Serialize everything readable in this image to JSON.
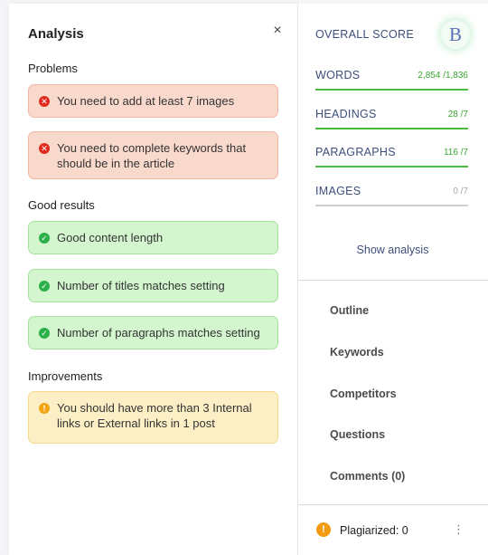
{
  "analysis": {
    "title": "Analysis",
    "close_glyph": "×",
    "problems": {
      "heading": "Problems",
      "items": [
        "You need to add at least 7 images",
        "You need to complete keywords that should be in the article"
      ]
    },
    "good": {
      "heading": "Good results",
      "items": [
        "Good content length",
        "Number of titles matches setting",
        "Number of paragraphs matches setting"
      ]
    },
    "improvements": {
      "heading": "Improvements",
      "items": [
        "You should have more than 3 Internal links or External links in 1 post"
      ]
    }
  },
  "score": {
    "label": "OVERALL SCORE",
    "grade": "B",
    "metrics": [
      {
        "label": "WORDS",
        "value": "2,854 /1,836",
        "status": "good"
      },
      {
        "label": "HEADINGS",
        "value": "28 /7",
        "status": "good"
      },
      {
        "label": "PARAGRAPHS",
        "value": "116 /7",
        "status": "good"
      },
      {
        "label": "IMAGES",
        "value": "0 /7",
        "status": "neutral"
      }
    ],
    "show_analysis": "Show analysis"
  },
  "nav": {
    "items": [
      "Outline",
      "Keywords",
      "Competitors",
      "Questions",
      "Comments (0)"
    ]
  },
  "plagiarism": {
    "label": "Plagiarized: 0",
    "icon": "!",
    "menu_glyph": "⋮"
  },
  "colors": {
    "error": "#e12b1f",
    "good": "#2bb04a",
    "warning": "#f2a413",
    "accent": "#3c4e7a"
  }
}
